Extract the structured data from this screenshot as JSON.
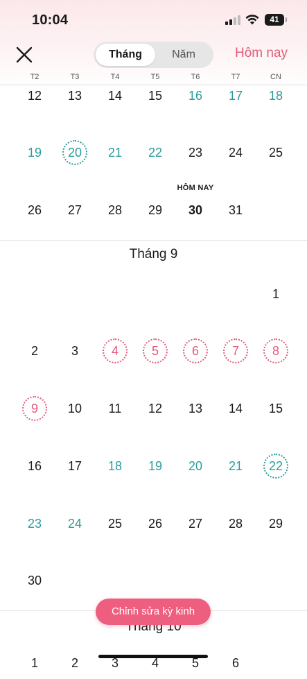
{
  "status_bar": {
    "time": "10:04",
    "battery": "41"
  },
  "nav": {
    "view_toggle": {
      "month": "Tháng",
      "year": "Năm"
    },
    "today_button": "Hôm nay"
  },
  "weekdays": [
    "T2",
    "T3",
    "T4",
    "T5",
    "T6",
    "T7",
    "CN"
  ],
  "today_label": "HÔM NAY",
  "months": [
    {
      "title": "",
      "weeks": [
        [
          {
            "d": "12"
          },
          {
            "d": "13"
          },
          {
            "d": "14"
          },
          {
            "d": "15"
          },
          {
            "d": "16",
            "style": "teal"
          },
          {
            "d": "17",
            "style": "teal"
          },
          {
            "d": "18",
            "style": "teal"
          }
        ],
        [
          {
            "d": "19",
            "style": "teal"
          },
          {
            "d": "20",
            "style": "dot-teal"
          },
          {
            "d": "21",
            "style": "teal"
          },
          {
            "d": "22",
            "style": "teal"
          },
          {
            "d": "23"
          },
          {
            "d": "24"
          },
          {
            "d": "25"
          }
        ],
        [
          {
            "d": "26"
          },
          {
            "d": "27"
          },
          {
            "d": "28"
          },
          {
            "d": "29"
          },
          {
            "d": "30",
            "style": "today"
          },
          {
            "d": "31"
          },
          null
        ]
      ]
    },
    {
      "title": "Tháng 9",
      "weeks": [
        [
          null,
          null,
          null,
          null,
          null,
          null,
          {
            "d": "1"
          }
        ],
        [
          {
            "d": "2"
          },
          {
            "d": "3"
          },
          {
            "d": "4",
            "style": "dot-pink"
          },
          {
            "d": "5",
            "style": "dot-pink"
          },
          {
            "d": "6",
            "style": "dot-pink"
          },
          {
            "d": "7",
            "style": "dot-pink"
          },
          {
            "d": "8",
            "style": "dot-pink"
          }
        ],
        [
          {
            "d": "9",
            "style": "dot-pink"
          },
          {
            "d": "10"
          },
          {
            "d": "11"
          },
          {
            "d": "12"
          },
          {
            "d": "13"
          },
          {
            "d": "14"
          },
          {
            "d": "15"
          }
        ],
        [
          {
            "d": "16"
          },
          {
            "d": "17"
          },
          {
            "d": "18",
            "style": "teal"
          },
          {
            "d": "19",
            "style": "teal"
          },
          {
            "d": "20",
            "style": "teal"
          },
          {
            "d": "21",
            "style": "teal"
          },
          {
            "d": "22",
            "style": "dot-teal"
          }
        ],
        [
          {
            "d": "23",
            "style": "teal"
          },
          {
            "d": "24",
            "style": "teal"
          },
          {
            "d": "25"
          },
          {
            "d": "26"
          },
          {
            "d": "27"
          },
          {
            "d": "28"
          },
          {
            "d": "29"
          }
        ],
        [
          {
            "d": "30"
          },
          null,
          null,
          null,
          null,
          null,
          null
        ]
      ]
    },
    {
      "title": "Tháng 10",
      "weeks": [
        [
          {
            "d": "1"
          },
          {
            "d": "2"
          },
          {
            "d": "3"
          },
          {
            "d": "4"
          },
          {
            "d": "5"
          },
          {
            "d": "6"
          },
          null
        ]
      ]
    }
  ],
  "edit_button": "Chỉnh sửa kỳ kinh",
  "colors": {
    "accent_pink": "#e35a78",
    "button_pink": "#ee5e7f",
    "teal": "#2a9d9a"
  },
  "icons": {
    "close": "close-icon",
    "wifi": "wifi-icon",
    "signal": "cellular-signal-icon",
    "battery": "battery-icon"
  }
}
